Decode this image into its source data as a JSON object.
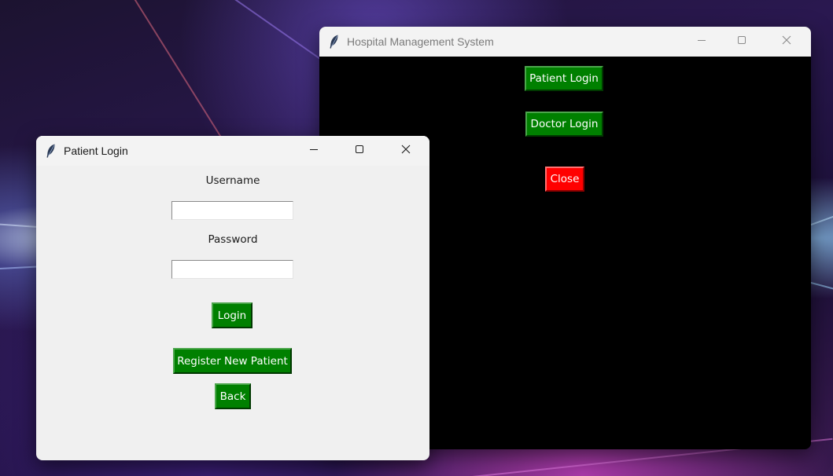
{
  "main_window": {
    "title": "Hospital Management System",
    "buttons": {
      "patient_login": "Patient Login",
      "doctor_login": "Doctor Login",
      "close": "Close"
    }
  },
  "login_window": {
    "title": "Patient Login",
    "username_label": "Username",
    "username_value": "",
    "password_label": "Password",
    "password_value": "",
    "buttons": {
      "login": "Login",
      "register": "Register New Patient",
      "back": "Back"
    }
  },
  "icons": {
    "app_icon": "feather-icon",
    "minimize": "minimize-icon",
    "maximize": "maximize-icon",
    "close": "close-icon"
  },
  "colors": {
    "button_green": "#008000",
    "button_red": "#ff0000",
    "main_background": "#000000",
    "dialog_background": "#f0f0f0"
  }
}
